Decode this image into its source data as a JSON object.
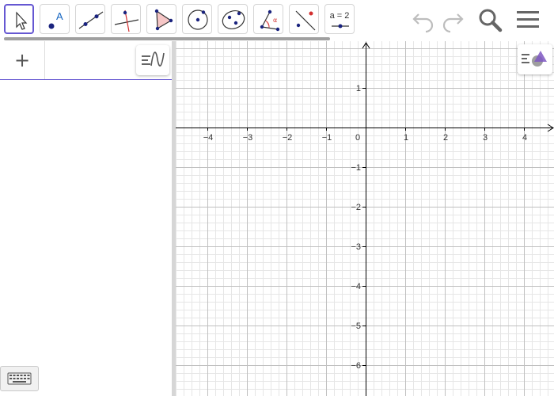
{
  "toolbar": {
    "tools": [
      {
        "name": "move",
        "icon": "cursor-arrow-icon",
        "selected": true
      },
      {
        "name": "point",
        "icon": "point-icon"
      },
      {
        "name": "line",
        "icon": "line-through-points-icon"
      },
      {
        "name": "perpendicular",
        "icon": "perpendicular-line-icon"
      },
      {
        "name": "polygon",
        "icon": "polygon-icon"
      },
      {
        "name": "circle",
        "icon": "circle-center-point-icon"
      },
      {
        "name": "ellipse",
        "icon": "ellipse-icon"
      },
      {
        "name": "angle",
        "icon": "angle-icon"
      },
      {
        "name": "reflect",
        "icon": "reflect-line-icon"
      },
      {
        "name": "slider",
        "icon": "slider-icon",
        "label": "a = 2"
      }
    ],
    "undo_icon": "undo-icon",
    "redo_icon": "redo-icon",
    "search_icon": "search-icon",
    "menu_icon": "hamburger-menu-icon"
  },
  "algebra": {
    "input_icon": "plus-icon",
    "input_label": "+",
    "menu_icon": "algebra-view-menu-icon",
    "keyboard_icon": "keyboard-icon"
  },
  "graphics": {
    "style_icon": "graphics-style-icon",
    "x_ticks": [
      "−4",
      "−3",
      "−2",
      "−1",
      "0",
      "1",
      "2",
      "3",
      "4"
    ],
    "y_ticks": [
      "1",
      "−1",
      "−2",
      "−3",
      "−4",
      "−5",
      "−6"
    ],
    "colors": {
      "axis": "#000000",
      "major_grid": "#c0c0c0",
      "minor_grid": "#e6e6e6",
      "accent": "#6557d2"
    }
  }
}
